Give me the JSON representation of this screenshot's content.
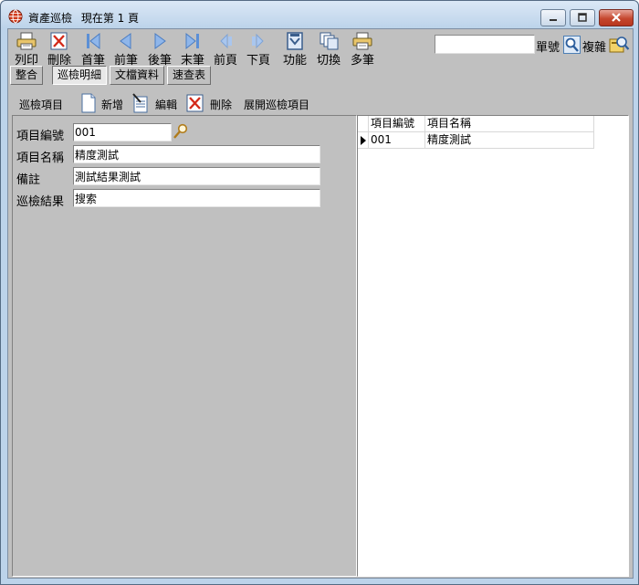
{
  "window": {
    "title": "資產巡檢",
    "page_status": "現在第 1 頁"
  },
  "toolbar": {
    "buttons": [
      {
        "label": "列印",
        "icon": "printer-icon"
      },
      {
        "label": "刪除",
        "icon": "delete-icon"
      },
      {
        "label": "首筆",
        "icon": "first-record-icon"
      },
      {
        "label": "前筆",
        "icon": "prev-record-icon"
      },
      {
        "label": "後筆",
        "icon": "next-record-icon"
      },
      {
        "label": "末筆",
        "icon": "last-record-icon"
      },
      {
        "label": "前頁",
        "icon": "prev-page-icon"
      },
      {
        "label": "下頁",
        "icon": "next-page-icon"
      },
      {
        "label": "功能",
        "icon": "function-icon"
      },
      {
        "label": "切換",
        "icon": "switch-icon"
      },
      {
        "label": "多筆",
        "icon": "multi-record-icon"
      }
    ],
    "search_value": "",
    "search_label": "單號",
    "complex_label": "複雜"
  },
  "tabs": [
    {
      "label": "整合",
      "active": false
    },
    {
      "label": "巡檢明細",
      "active": true
    },
    {
      "label": "文檔資料",
      "active": false
    },
    {
      "label": "速查表",
      "active": false
    }
  ],
  "detail_bar": {
    "section_label": "巡檢項目",
    "add_label": "新增",
    "edit_label": "編輯",
    "delete_label": "刪除",
    "expand_label": "展開巡檢項目"
  },
  "form": {
    "item_no_label": "項目編號",
    "item_no_value": "001",
    "item_name_label": "項目名稱",
    "item_name_value": "精度測試",
    "remark_label": "備註",
    "remark_value": "測試結果測試",
    "result_label": "巡檢結果",
    "result_value": "搜索"
  },
  "grid": {
    "columns": [
      "項目編號",
      "項目名稱"
    ],
    "rows": [
      {
        "item_no": "001",
        "item_name": "精度測試"
      }
    ]
  },
  "colors": {
    "window_frame": "#bcd3ea",
    "client_background": "#c0c0c0",
    "close_button": "#c5472e"
  }
}
